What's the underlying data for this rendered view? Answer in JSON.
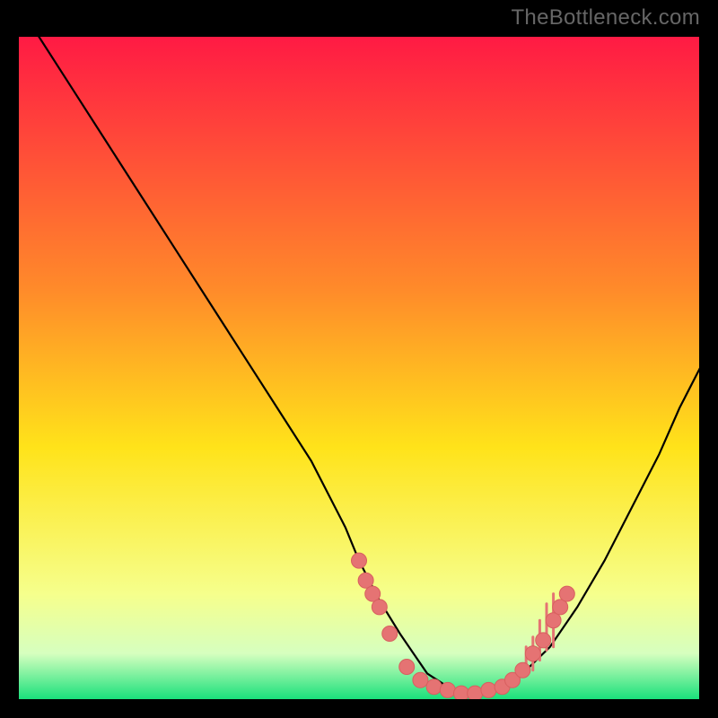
{
  "watermark": "TheBottleneck.com",
  "colors": {
    "gradient_top": "#ff1a44",
    "gradient_mid1": "#ff8a2a",
    "gradient_mid2": "#ffe31a",
    "gradient_mid3": "#f6ff8c",
    "gradient_low": "#d6ffbf",
    "gradient_bottom": "#16e07a",
    "curve": "#000000",
    "marker": "#e57373",
    "marker_edge": "#d85f5f",
    "bg": "#000000"
  },
  "chart_data": {
    "type": "line",
    "title": "",
    "xlabel": "",
    "ylabel": "",
    "xlim": [
      0,
      100
    ],
    "ylim": [
      0,
      100
    ],
    "grid": false,
    "legend": false,
    "series": [
      {
        "name": "curve",
        "x": [
          3,
          8,
          13,
          18,
          23,
          28,
          33,
          38,
          43,
          48,
          50,
          53,
          56,
          58,
          60,
          63,
          65,
          68,
          71,
          74,
          78,
          82,
          86,
          90,
          94,
          97,
          100
        ],
        "y": [
          100,
          92,
          84,
          76,
          68,
          60,
          52,
          44,
          36,
          26,
          21,
          15,
          10,
          7,
          4,
          2,
          1,
          1,
          2,
          4,
          8,
          14,
          21,
          29,
          37,
          44,
          50
        ]
      }
    ],
    "markers": [
      {
        "x": 50,
        "y": 21
      },
      {
        "x": 51,
        "y": 18
      },
      {
        "x": 52,
        "y": 16
      },
      {
        "x": 53,
        "y": 14
      },
      {
        "x": 54.5,
        "y": 10
      },
      {
        "x": 57,
        "y": 5
      },
      {
        "x": 59,
        "y": 3
      },
      {
        "x": 61,
        "y": 2
      },
      {
        "x": 63,
        "y": 1.5
      },
      {
        "x": 65,
        "y": 1
      },
      {
        "x": 67,
        "y": 1
      },
      {
        "x": 69,
        "y": 1.5
      },
      {
        "x": 71,
        "y": 2
      },
      {
        "x": 72.5,
        "y": 3
      },
      {
        "x": 74,
        "y": 4.5
      },
      {
        "x": 75.5,
        "y": 7
      },
      {
        "x": 77,
        "y": 9
      },
      {
        "x": 78.5,
        "y": 12
      },
      {
        "x": 79.5,
        "y": 14
      },
      {
        "x": 80.5,
        "y": 16
      }
    ],
    "ticks_right": [
      {
        "x": 74.5,
        "y": 6,
        "h": 4
      },
      {
        "x": 75.5,
        "y": 7,
        "h": 5
      },
      {
        "x": 76.5,
        "y": 9,
        "h": 6
      },
      {
        "x": 77.5,
        "y": 11,
        "h": 7
      },
      {
        "x": 78.5,
        "y": 12,
        "h": 8
      }
    ]
  }
}
